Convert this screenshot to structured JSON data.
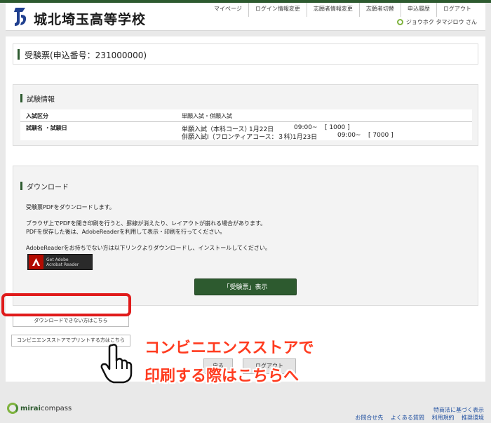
{
  "header": {
    "school_name": "城北埼玉高等学校",
    "nav": [
      "マイページ",
      "ログイン情報変更",
      "志願者情報変更",
      "志願者切替",
      "申込履歴",
      "ログアウト"
    ],
    "user_name": "ジョウホク タマジロウ さん"
  },
  "page": {
    "title": "受験票(申込番号：231000000)"
  },
  "exam_info": {
    "heading": "試験情報",
    "category_label": "入試区分",
    "category_value": "単願入試・併願入試",
    "exam_label": "試験名 ・試験日",
    "exams": [
      {
        "name": "単願入試（本科コース）",
        "date": "1月22日",
        "time": "09:00~",
        "fee": "[ 1000 ]"
      },
      {
        "name": "併願入試Ⅰ（フロンティアコース：３科）",
        "date": "1月23日",
        "time": "09:00~",
        "fee": "[ 7000 ]"
      }
    ]
  },
  "download": {
    "heading": "ダウンロード",
    "lines": [
      "受験票PDFをダウンロードします。",
      "ブラウザ上でPDFを開き印刷を行うと、罫線が消えたり、レイアウトが崩れる場合があります。",
      "PDFを保存した後は、AdobeReaderを利用して表示・印刷を行ってください。",
      "AdobeReaderをお持ちでない方は以下リンクよりダウンロードし、インストールしてください。"
    ],
    "acrobat_line1": "Get Adobe",
    "acrobat_line2": "Acrobat Reader",
    "show_button": "「受験票」表示"
  },
  "links": {
    "cannot_download": "ダウンロードできない方はこちら",
    "convenience_store": "コンビニエンスストアでプリントする方はこちら",
    "back": "戻る",
    "logout": "ログアウト"
  },
  "annotation": {
    "line1": "コンビニエンスストアで",
    "line2": "印刷する際はこちらへ"
  },
  "footer": {
    "logo_a": "mirai",
    "logo_b": "compass",
    "link_row1": [
      "特商法に基づく表示"
    ],
    "link_row2": [
      "お問合せ先",
      "よくある質問",
      "利用規約",
      "推奨環境"
    ]
  }
}
